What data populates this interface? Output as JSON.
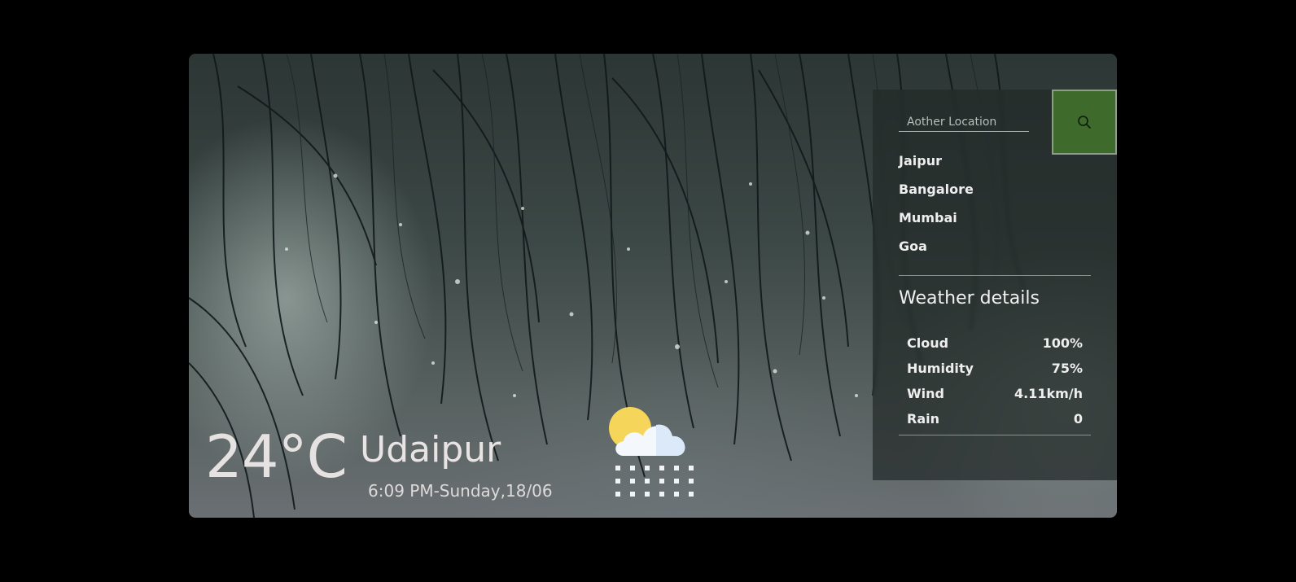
{
  "search": {
    "placeholder": "Aother Location",
    "button_icon": "search-icon"
  },
  "cities": [
    "Jaipur",
    "Bangalore",
    "Mumbai",
    "Goa"
  ],
  "details": {
    "title": "Weather details",
    "rows": [
      {
        "label": "Cloud",
        "value": "100%"
      },
      {
        "label": "Humidity",
        "value": "75%"
      },
      {
        "label": "Wind",
        "value": "4.11km/h"
      },
      {
        "label": "Rain",
        "value": "0"
      }
    ]
  },
  "current": {
    "temperature": "24°C",
    "city": "Udaipur",
    "datetime": "6:09 PM-Sunday,18/06",
    "icon": "sun-cloud-rain-icon"
  },
  "colors": {
    "search_button": "#3e6a2c",
    "panel": "#232a28"
  }
}
